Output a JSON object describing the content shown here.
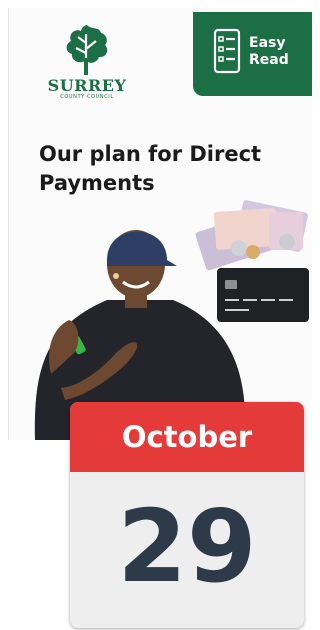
{
  "logo": {
    "name": "SURREY",
    "sub": "COUNTY COUNCIL",
    "icon": "oak-leaf-icon",
    "color": "#1c6e45"
  },
  "easy_read": {
    "label_line1": "Easy",
    "label_line2": "Read",
    "icon": "checklist-icon",
    "color": "#1c6e45"
  },
  "title": {
    "line1": "Our plan for Direct",
    "line2": "Payments"
  },
  "images": {
    "money": "banknotes-and-bank-card-illustration",
    "person": "person-in-cap-signing-photo"
  },
  "calendar": {
    "month": "October",
    "day": "29",
    "month_color": "#e53a3a",
    "day_color": "#2c3a49"
  }
}
